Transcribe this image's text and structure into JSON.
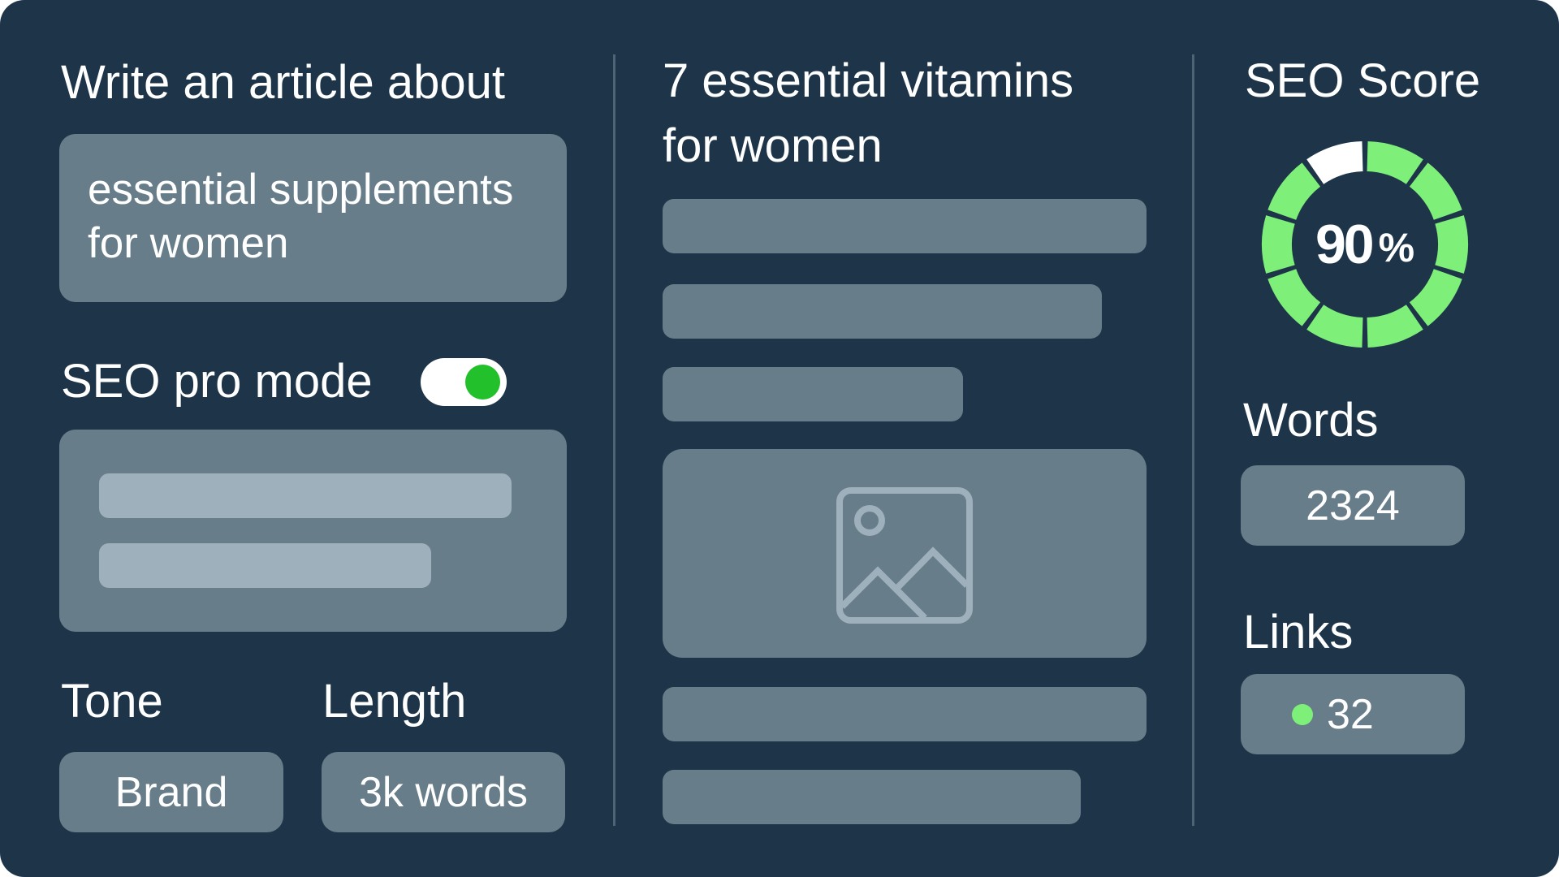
{
  "left": {
    "title": "Write an article about",
    "topic_input": {
      "line1": "essential supplements",
      "line2": "for women"
    },
    "seo_pro_mode": {
      "label": "SEO pro mode",
      "enabled": true,
      "accent": "#22c02a"
    },
    "tone": {
      "label": "Tone",
      "value": "Brand"
    },
    "length": {
      "label": "Length",
      "value": "3k words"
    }
  },
  "middle": {
    "title_line1": "7 essential vitamins",
    "title_line2": "for women",
    "image_icon": "image-placeholder-icon"
  },
  "right": {
    "seo_score": {
      "label": "SEO Score",
      "value": "90",
      "unit": "%",
      "percent": 90,
      "segments": 10,
      "fill_color": "#7ef07a",
      "empty_color": "#ffffff"
    },
    "words": {
      "label": "Words",
      "value": "2324"
    },
    "links": {
      "label": "Links",
      "value": "32",
      "dot_color": "#7ef07a"
    }
  }
}
